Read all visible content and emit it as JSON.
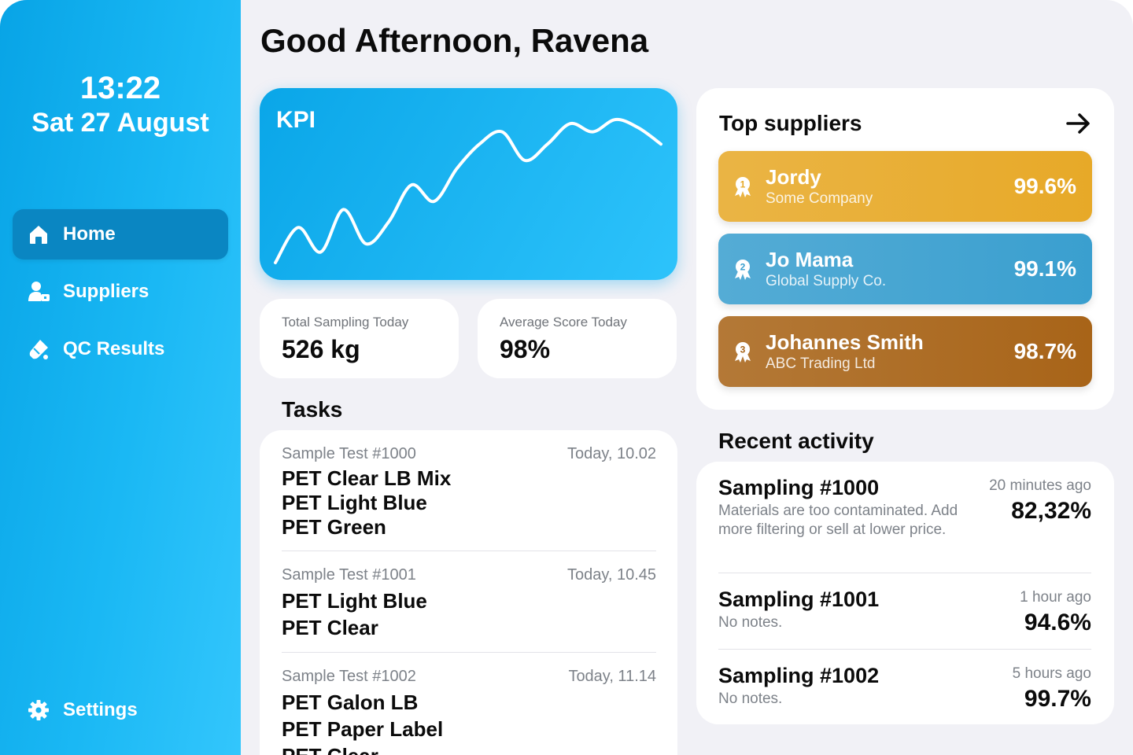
{
  "header": {
    "greeting": "Good Afternoon, Ravena"
  },
  "sidebar": {
    "time": "13:22",
    "date": "Sat 27 August",
    "items": [
      {
        "label": "Home",
        "icon": "home-icon",
        "active": true
      },
      {
        "label": "Suppliers",
        "icon": "suppliers-icon",
        "active": false
      },
      {
        "label": "QC Results",
        "icon": "qc-results-icon",
        "active": false
      }
    ],
    "settings": {
      "label": "Settings",
      "icon": "gear-icon"
    }
  },
  "kpi": {
    "title": "KPI",
    "trend": [
      5,
      48,
      18,
      70,
      28,
      55,
      100,
      80,
      120,
      150,
      165,
      130,
      150,
      175,
      165,
      180,
      170,
      150
    ]
  },
  "stats": {
    "total_sampling": {
      "label": "Total Sampling Today",
      "value": "526 kg"
    },
    "average_score": {
      "label": "Average Score Today",
      "value": "98%"
    }
  },
  "tasks": {
    "title": "Tasks",
    "items": [
      {
        "title": "Sample Test #1000",
        "time": "Today, 10.02",
        "materials": [
          "PET Clear LB Mix",
          "PET Light Blue",
          "PET Green"
        ]
      },
      {
        "title": "Sample Test #1001",
        "time": "Today, 10.45",
        "materials": [
          "PET Light Blue",
          "PET Clear"
        ]
      },
      {
        "title": "Sample Test #1002",
        "time": "Today, 11.14",
        "materials": [
          "PET Galon LB",
          "PET Paper Label",
          "PET Clear"
        ]
      }
    ]
  },
  "suppliers": {
    "title": "Top suppliers",
    "items": [
      {
        "rank": "1",
        "name": "Jordy",
        "company": "Some Company",
        "score": "99.6%",
        "color": "#e7a928"
      },
      {
        "rank": "2",
        "name": "Jo Mama",
        "company": "Global Supply Co.",
        "score": "99.1%",
        "color": "#3a9fcf"
      },
      {
        "rank": "3",
        "name": "Johannes Smith",
        "company": "ABC Trading Ltd",
        "score": "98.7%",
        "color": "#a86418"
      }
    ]
  },
  "activity": {
    "title": "Recent activity",
    "items": [
      {
        "name": "Sampling #1000",
        "note": "Materials are too contaminated. Add more filtering or sell at lower price.",
        "when": "20 minutes ago",
        "value": "82,32%"
      },
      {
        "name": "Sampling #1001",
        "note": "No notes.",
        "when": "1 hour ago",
        "value": "94.6%"
      },
      {
        "name": "Sampling #1002",
        "note": "No notes.",
        "when": "5 hours ago",
        "value": "99.7%"
      }
    ]
  }
}
